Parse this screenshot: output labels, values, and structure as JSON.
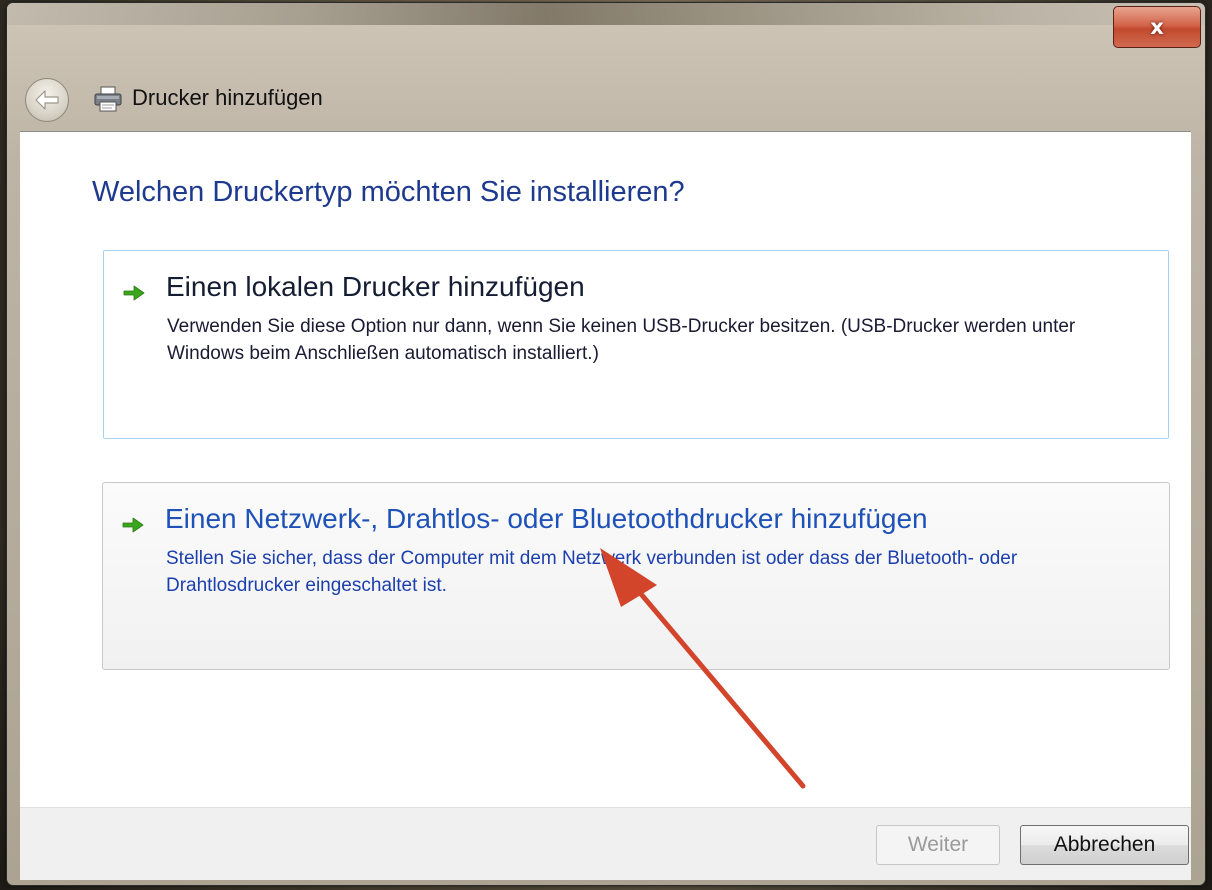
{
  "window": {
    "title": "Drucker hinzufügen",
    "close_label": "x"
  },
  "main": {
    "heading": "Welchen Druckertyp möchten Sie installieren?",
    "options": [
      {
        "title": "Einen lokalen Drucker hinzufügen",
        "description": "Verwenden Sie diese Option nur dann, wenn Sie keinen USB-Drucker besitzen. (USB-Drucker werden unter Windows beim Anschließen automatisch installiert.)"
      },
      {
        "title": "Einen Netzwerk-, Drahtlos- oder Bluetoothdrucker hinzufügen",
        "description": "Stellen Sie sicher, dass der Computer mit dem Netzwerk verbunden ist oder dass der Bluetooth- oder Drahtlosdrucker eingeschaltet ist."
      }
    ]
  },
  "footer": {
    "next_label": "Weiter",
    "cancel_label": "Abbrechen"
  },
  "icons": {
    "back": "back-arrow-icon",
    "printer": "printer-icon",
    "option_arrow": "green-arrow-icon",
    "annotation": "red-arrow-annotation"
  },
  "colors": {
    "heading_blue": "#1e3a8e",
    "link_blue": "#1f52b8",
    "close_red": "#c24a2e",
    "annotation_red": "#d2452b",
    "arrow_green": "#3aa61c"
  }
}
